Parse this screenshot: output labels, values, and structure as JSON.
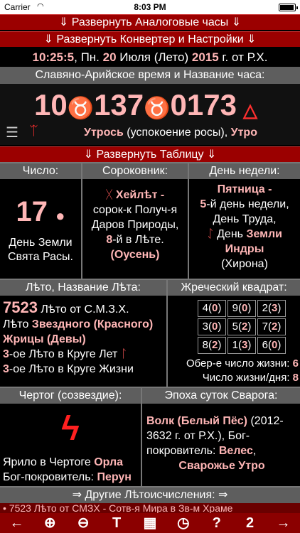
{
  "status_bar": {
    "carrier": "Carrier",
    "time": "8:03 PM"
  },
  "buttons": {
    "analog_clock": "⇓ Развернуть Аналоговые часы ⇓",
    "converter": "⇓ Развернуть Конвертер и Настройки ⇓",
    "table": "⇓ Развернуть Таблицу ⇓",
    "other_chronology": "⇒ Другие Лѣтоисчисления: ⇒"
  },
  "date_line": {
    "time": "10:25:5",
    "sep1": ", Пн. ",
    "day": "20",
    "month": " Июля (Лето) ",
    "year": "2015",
    "suffix": " г. от Р.Х."
  },
  "slavic_time": {
    "title": "Славяно-Арийское время и Название часа:",
    "hour": "10",
    "part": "137",
    "share": "0173",
    "name_main": "Утрось",
    "name_desc": " (успокоение росы), ",
    "name_period": "Утро"
  },
  "table": {
    "number": {
      "title": "Число:",
      "value": "17",
      "line1": "День Земли",
      "line2": "Свята Расы."
    },
    "sorokovnik": {
      "title": "Сороковник:",
      "name": "Хейлѣт -",
      "line2": "сорок-к Получ-я",
      "line3": "Даров Природы,",
      "num": "8",
      "line4": "-й в Лѣте.",
      "season": "(Оусень)"
    },
    "weekday": {
      "title": "День недели:",
      "name": "Пятница -",
      "num": "5",
      "line2": "-й день недели,",
      "line3": "День Труда,",
      "line4a": "День ",
      "line4b": "Земли",
      "line5": "Индры",
      "line6": "(Хирона)"
    },
    "leto": {
      "title": "Лѣто, Название Лѣта:",
      "year": "7523",
      "year_suffix": " Лѣто от С.М.З.Х.",
      "name_prefix": "Лѣто ",
      "name_a": "Звездного (Красного)",
      "name_b": "Жрицы (Девы)",
      "circle_years_num": "3",
      "circle_years": "-ое Лѣто в Круге Лет",
      "circle_life_num": "3",
      "circle_life": "-ое Лѣто в Круге Жизни"
    },
    "square": {
      "title": "Жреческий квадрат:",
      "cells": [
        [
          "4",
          "0",
          "9",
          "0",
          "2",
          "3"
        ],
        [
          "3",
          "0",
          "5",
          "2",
          "7",
          "2"
        ],
        [
          "8",
          "2",
          "1",
          "3",
          "6",
          "0"
        ]
      ],
      "life_number_label": "Обер-е число жизни: ",
      "life_number": "6",
      "life_day_label": "Число жизни/дня: ",
      "life_day": "8"
    },
    "chertog": {
      "title": "Чертог (созвездие):",
      "line1a": "Ярило в Чертоге ",
      "line1b": "Орла",
      "line2a": "Бог-покровитель: ",
      "line2b": "Перун"
    },
    "epoch": {
      "title": "Эпоха суток Сварога:",
      "name": "Волк (Белый Пёс)",
      "years": " (2012-3632 г. от Р.Х.), Бог-покровитель: ",
      "god": "Велес",
      "period": "Сварожье Утро"
    }
  },
  "ticker": "• 7523 Лѣто от СМЗХ - Сотв-я Мира в Зв-м Храме",
  "tabbar": [
    "←",
    "⊕",
    "⊖",
    "T",
    "▦",
    "◷",
    "?",
    "2",
    "→"
  ]
}
